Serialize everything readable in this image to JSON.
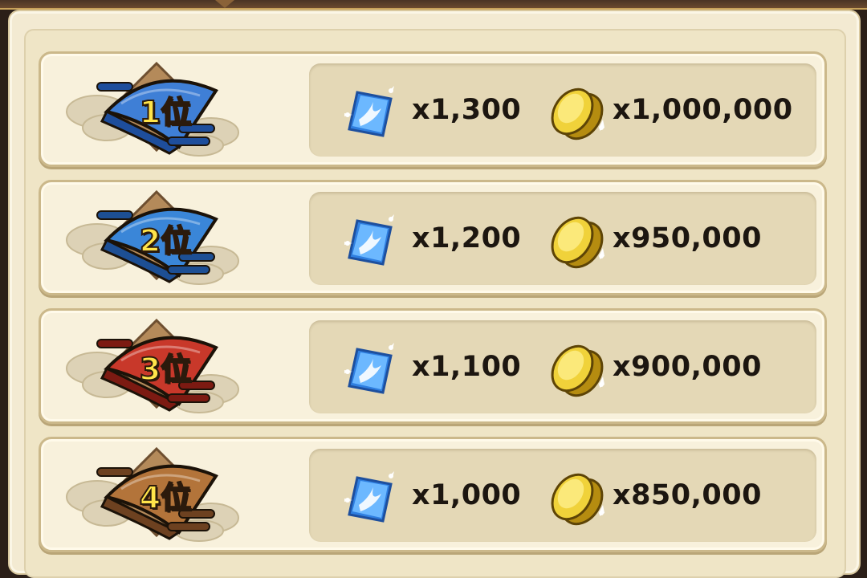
{
  "rewards": [
    {
      "rank": "1位",
      "gem_amount": "x1,300",
      "coin_amount": "x1,000,000",
      "fan_color": "#3f7fd6",
      "fan_dark": "#1e4e9c"
    },
    {
      "rank": "2位",
      "gem_amount": "x1,200",
      "coin_amount": "x950,000",
      "fan_color": "#3a86d8",
      "fan_dark": "#1d4f94"
    },
    {
      "rank": "3位",
      "gem_amount": "x1,100",
      "coin_amount": "x900,000",
      "fan_color": "#c8382a",
      "fan_dark": "#7c1a12"
    },
    {
      "rank": "4位",
      "gem_amount": "x1,000",
      "coin_amount": "x850,000",
      "fan_color": "#b3743a",
      "fan_dark": "#6d4120"
    }
  ],
  "icons": {
    "gem": "crystal-gem-icon",
    "coin": "gold-koban-coin-icon",
    "badge": "folding-fan-rank-badge"
  }
}
